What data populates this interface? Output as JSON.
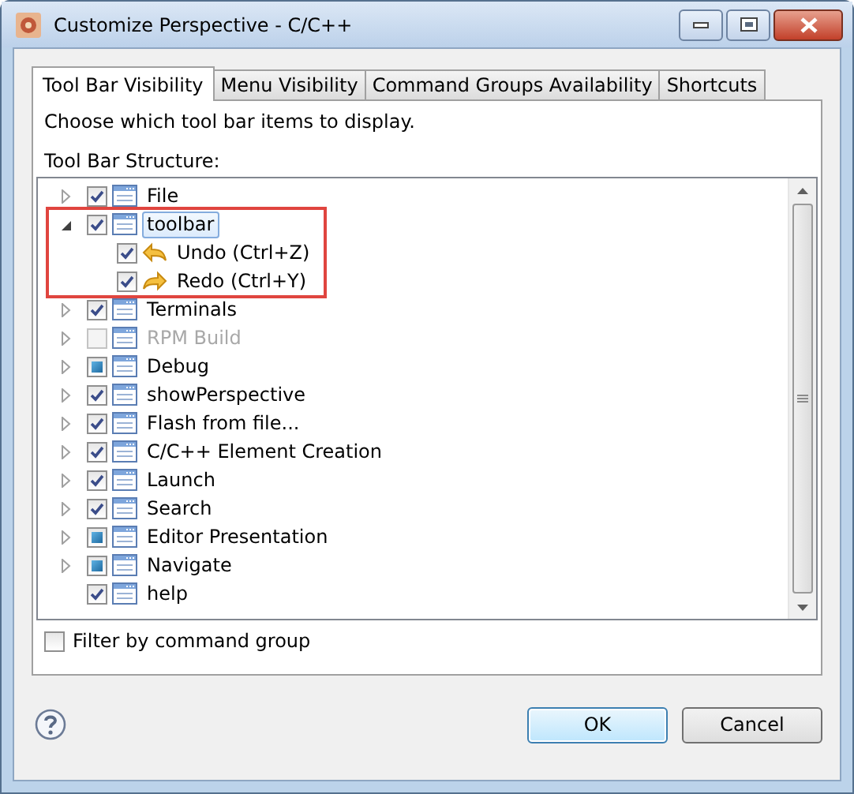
{
  "window": {
    "title": "Customize Perspective - C/C++"
  },
  "tabs": [
    {
      "label": "Tool Bar Visibility",
      "selected": true
    },
    {
      "label": "Menu Visibility",
      "selected": false
    },
    {
      "label": "Command Groups Availability",
      "selected": false
    },
    {
      "label": "Shortcuts",
      "selected": false
    }
  ],
  "description": "Choose which tool bar items to display.",
  "tree_label": "Tool Bar Structure:",
  "tree": [
    {
      "label": "File",
      "kind": "toolbar",
      "checked": true,
      "partial": false,
      "disabled": false,
      "expanded": false,
      "selected": false,
      "highlighted": false
    },
    {
      "label": "toolbar",
      "kind": "toolbar",
      "checked": true,
      "partial": false,
      "disabled": false,
      "expanded": true,
      "selected": true,
      "highlighted": true,
      "children": [
        {
          "label": "Undo (Ctrl+Z)",
          "kind": "undo",
          "checked": true,
          "partial": false,
          "disabled": false,
          "selected": false
        },
        {
          "label": "Redo (Ctrl+Y)",
          "kind": "redo",
          "checked": true,
          "partial": false,
          "disabled": false,
          "selected": false
        }
      ]
    },
    {
      "label": "Terminals",
      "kind": "toolbar",
      "checked": true,
      "partial": false,
      "disabled": false,
      "expanded": false,
      "selected": false,
      "highlighted": false
    },
    {
      "label": "RPM Build",
      "kind": "toolbar",
      "checked": false,
      "partial": false,
      "disabled": true,
      "expanded": false,
      "selected": false,
      "highlighted": false
    },
    {
      "label": "Debug",
      "kind": "toolbar",
      "checked": true,
      "partial": true,
      "disabled": false,
      "expanded": false,
      "selected": false,
      "highlighted": false
    },
    {
      "label": "showPerspective",
      "kind": "toolbar",
      "checked": true,
      "partial": false,
      "disabled": false,
      "expanded": false,
      "selected": false,
      "highlighted": false
    },
    {
      "label": "Flash from file...",
      "kind": "toolbar",
      "checked": true,
      "partial": false,
      "disabled": false,
      "expanded": false,
      "selected": false,
      "highlighted": false
    },
    {
      "label": "C/C++ Element Creation",
      "kind": "toolbar",
      "checked": true,
      "partial": false,
      "disabled": false,
      "expanded": false,
      "selected": false,
      "highlighted": false
    },
    {
      "label": "Launch",
      "kind": "toolbar",
      "checked": true,
      "partial": false,
      "disabled": false,
      "expanded": false,
      "selected": false,
      "highlighted": false
    },
    {
      "label": "Search",
      "kind": "toolbar",
      "checked": true,
      "partial": false,
      "disabled": false,
      "expanded": false,
      "selected": false,
      "highlighted": false
    },
    {
      "label": "Editor Presentation",
      "kind": "toolbar",
      "checked": true,
      "partial": true,
      "disabled": false,
      "expanded": false,
      "selected": false,
      "highlighted": false
    },
    {
      "label": "Navigate",
      "kind": "toolbar",
      "checked": true,
      "partial": true,
      "disabled": false,
      "expanded": false,
      "selected": false,
      "highlighted": false
    },
    {
      "label": "help",
      "kind": "toolbar",
      "checked": true,
      "partial": false,
      "disabled": false,
      "selected": false,
      "highlighted": false
    }
  ],
  "filter": {
    "label": "Filter by command group",
    "checked": false
  },
  "buttons": [
    {
      "label": "OK",
      "default": true
    },
    {
      "label": "Cancel",
      "default": false
    }
  ]
}
